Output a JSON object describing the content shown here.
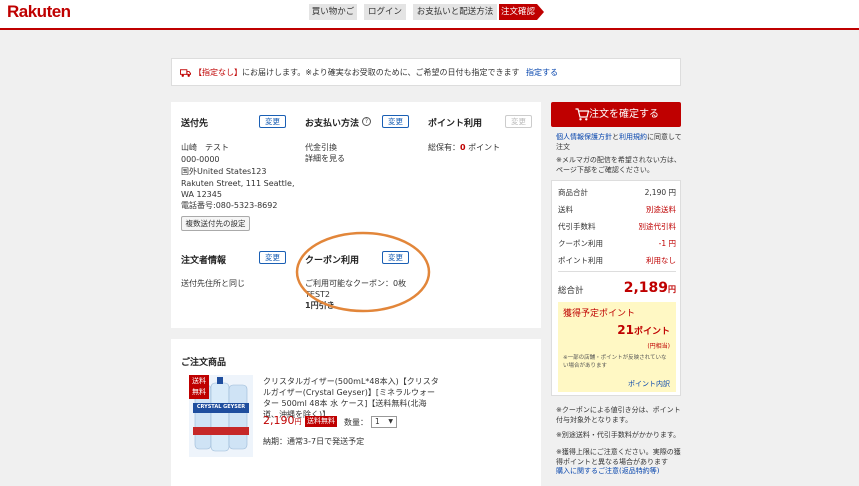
{
  "header": {
    "logo": "Rakuten",
    "steps": [
      {
        "label": "買い物かご"
      },
      {
        "label": "ログイン"
      },
      {
        "label": "お支払いと配送方法"
      },
      {
        "label": "注文確認"
      }
    ]
  },
  "notice": {
    "tag": "【指定なし】",
    "message": "にお届けします。※より確実なお受取のために、ご希望の日付も指定できます",
    "link": "指定する"
  },
  "shipping": {
    "title": "送付先",
    "change": "変更",
    "name": "山崎　テスト",
    "zip": "000-0000",
    "addr1": "国外United States123",
    "addr2": "Rakuten Street, 111 Seattle,",
    "addr3": "WA 12345",
    "phone": "電話番号:080-5323-8692",
    "multi_btn": "複数送付先の設定"
  },
  "payment": {
    "title": "お支払い方法",
    "help": "?",
    "change": "変更",
    "method": "代金引換",
    "detail_link": "詳細を見る"
  },
  "points": {
    "title": "ポイント利用",
    "change": "変更",
    "held_label": "総保有：",
    "held_value": "0",
    "held_unit": "ポイント"
  },
  "orderer": {
    "title": "注文者情報",
    "change": "変更",
    "text": "送付先住所と同じ"
  },
  "coupon": {
    "title": "クーポン利用",
    "change": "変更",
    "available": "ご利用可能なクーポン：",
    "available_count": "0枚",
    "code": "TEST2",
    "discount": "1円引き"
  },
  "product": {
    "section_title": "ご注文商品",
    "image_badge": "送料無料",
    "image_brand": "CRYSTAL GEYSER",
    "name": "クリスタルガイザー(500mL*48本入)【クリスタルガイザー(Crystal Geyser)】[ミネラルウォーター 500ml 48本 水 ケース]【送料無料(北海道、沖縄を除く)】",
    "price": "2,190",
    "price_unit": "円",
    "shipping_badge": "送料無料",
    "qty_label": "数量：",
    "qty_value": "1",
    "delivery": "納期：通常3-7日で発送予定"
  },
  "sidebar": {
    "confirm_btn": "注文を確定する",
    "agree_link1": "個人情報保護方針",
    "agree_mid": "と",
    "agree_link2": "利用規約",
    "agree_end": "に同意して",
    "agree_tail": "注文",
    "mail_note1": "※メルマガの配信を希望されない方は、",
    "mail_note2": "ページ下部をご確認ください。",
    "rows": [
      {
        "label": "商品合計",
        "value": "2,190 円",
        "color": "#333"
      },
      {
        "label": "送料",
        "value": "別途送料",
        "color": "#bf0000"
      },
      {
        "label": "代引手数料",
        "value": "別途代引料",
        "color": "#bf0000"
      },
      {
        "label": "クーポン利用",
        "value": "-1 円",
        "color": "#bf0000"
      },
      {
        "label": "ポイント利用",
        "value": "利用なし",
        "color": "#bf0000"
      }
    ],
    "total_label": "総合計",
    "total_value": "2,189",
    "total_unit": "円",
    "earn_title": "獲得予定ポイント",
    "earn_value": "21",
    "earn_unit": "ポイント",
    "earn_sub": "(円相当)",
    "earn_note": "※一部の店舗・ポイントが反映されていない場合があります",
    "earn_link": "ポイント内訳",
    "note1": "※クーポンによる値引き分は、ポイント付与対象外となります。",
    "note2": "※別途送料・代引手数料がかかります。",
    "note3": "※獲得上限にご注意ください。実際の獲得ポイントと異なる場合があります",
    "note3_link": "購入に関するご注意(返品特約等)"
  },
  "colors": {
    "brand": "#bf0000",
    "link": "#0645ad",
    "button_border": "#1a5fb4",
    "points_bg": "#fff8c4"
  }
}
